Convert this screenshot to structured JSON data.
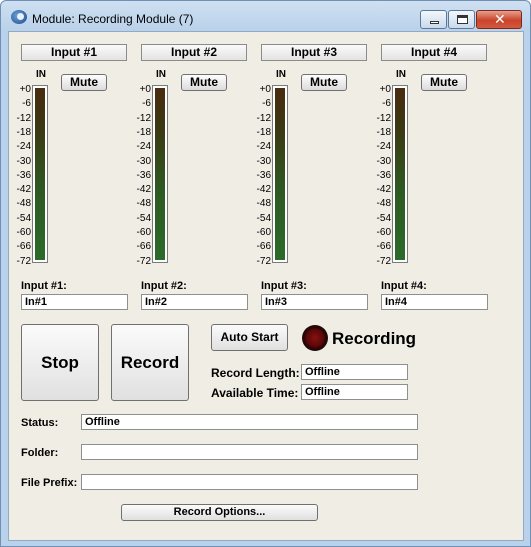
{
  "window": {
    "title": "Module: Recording Module (7)",
    "close_glyph": "✕"
  },
  "channels": [
    {
      "header": "Input #1",
      "in_label": "IN",
      "mute_label": "Mute",
      "field_label": "Input #1:",
      "field_value": "In#1"
    },
    {
      "header": "Input #2",
      "in_label": "IN",
      "mute_label": "Mute",
      "field_label": "Input #2:",
      "field_value": "In#2"
    },
    {
      "header": "Input #3",
      "in_label": "IN",
      "mute_label": "Mute",
      "field_label": "Input #3:",
      "field_value": "In#3"
    },
    {
      "header": "Input #4",
      "in_label": "IN",
      "mute_label": "Mute",
      "field_label": "Input #4:",
      "field_value": "In#4"
    }
  ],
  "meter_scale": [
    "+0",
    "-6",
    "-12",
    "-18",
    "-24",
    "-30",
    "-36",
    "-42",
    "-48",
    "-54",
    "-60",
    "-66",
    "-72"
  ],
  "transport": {
    "stop_label": "Stop",
    "record_label": "Record",
    "auto_start_label": "Auto Start",
    "recording_status": "Recording",
    "record_length_label": "Record Length:",
    "record_length_value": "Offline",
    "available_time_label": "Available Time:",
    "available_time_value": "Offline"
  },
  "details": {
    "status_label": "Status:",
    "status_value": "Offline",
    "folder_label": "Folder:",
    "folder_value": "",
    "file_prefix_label": "File Prefix:",
    "file_prefix_value": ""
  },
  "record_options_label": "Record Options..."
}
